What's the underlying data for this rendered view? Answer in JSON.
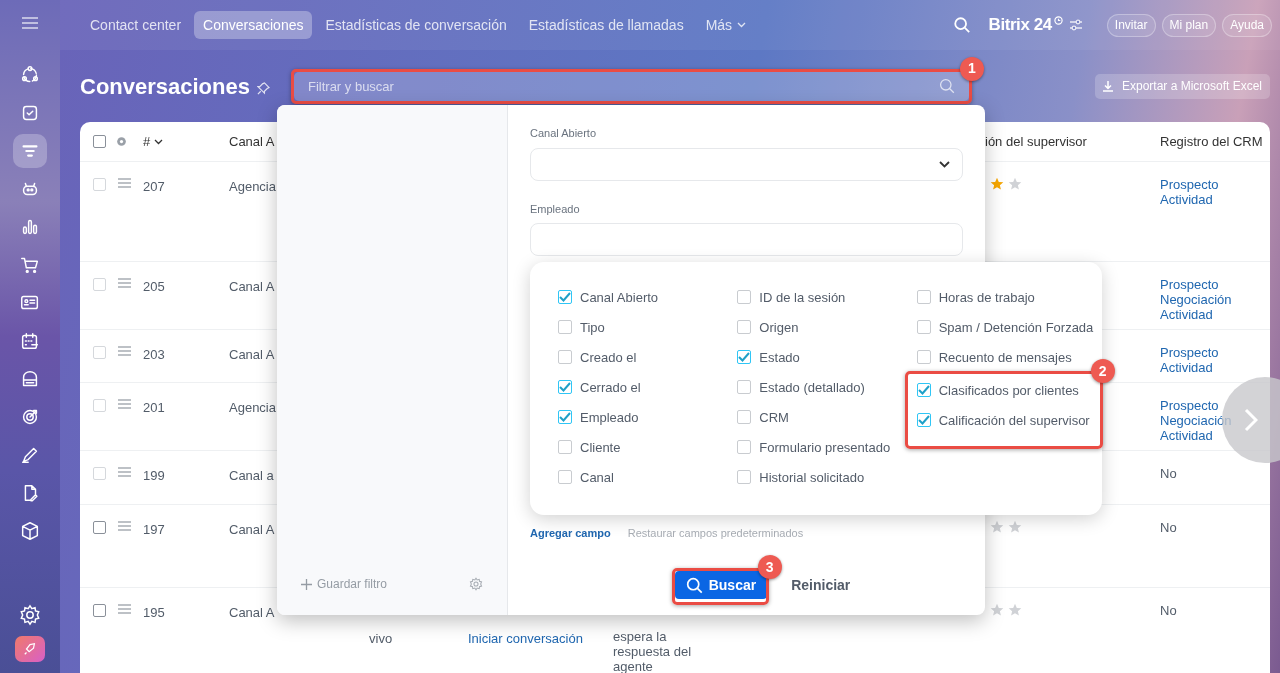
{
  "sidebar": {
    "items": [
      {
        "selected": false
      },
      {
        "selected": false
      },
      {
        "selected": true
      },
      {
        "selected": false
      },
      {
        "selected": false
      },
      {
        "selected": false
      },
      {
        "selected": false
      },
      {
        "selected": false
      },
      {
        "selected": false
      },
      {
        "selected": false
      },
      {
        "selected": false
      },
      {
        "selected": false
      },
      {
        "selected": false
      }
    ]
  },
  "top_nav": {
    "tabs": [
      {
        "label": "Contact center",
        "selected": false
      },
      {
        "label": "Conversaciones",
        "selected": true
      },
      {
        "label": "Estadísticas de conversación",
        "selected": false
      },
      {
        "label": "Estadísticas de llamadas",
        "selected": false
      },
      {
        "label": "Más",
        "selected": false
      }
    ],
    "logo": "Bitrix 24",
    "buttons": [
      "Invitar",
      "Mi plan",
      "Ayuda"
    ]
  },
  "page": {
    "title": "Conversaciones",
    "search": {
      "placeholder": "Filtrar y buscar",
      "callout": "1"
    },
    "export_button": "Exportar a Microsoft Excel"
  },
  "table": {
    "select_all_checked": false,
    "columns": [
      "#",
      "Canal A",
      "ión del supervisor",
      "Registro del CRM"
    ],
    "rows": [
      {
        "id": "207",
        "checked": false,
        "channel": "Agencia",
        "star_icons": [
          {
            "kind": "filled"
          },
          {
            "kind": "empty"
          }
        ],
        "crm": [
          "Prospecto",
          "Actividad"
        ]
      },
      {
        "id": "205",
        "checked": false,
        "channel": "Canal A",
        "crm": [
          "Prospecto",
          "Negociación",
          "Actividad"
        ]
      },
      {
        "id": "203",
        "checked": false,
        "channel": "Canal A",
        "crm": [
          "Prospecto",
          "Actividad"
        ]
      },
      {
        "id": "201",
        "checked": false,
        "channel": "Agencia",
        "crm": [
          "Prospecto",
          "Negociación",
          "Actividad"
        ]
      },
      {
        "id": "199",
        "checked": false,
        "channel": "Canal a",
        "crm_text": "No"
      },
      {
        "id": "197",
        "checked": false,
        "channel": "Canal A",
        "star_icons": [
          {
            "kind": "empty"
          },
          {
            "kind": "empty"
          }
        ],
        "crm_text": "No"
      },
      {
        "id": "195",
        "checked": false,
        "channel": "Canal A",
        "star_icons": [
          {
            "kind": "empty"
          },
          {
            "kind": "empty"
          }
        ],
        "crm_text": "No",
        "column_4": "vivo",
        "column_5": "Iniciar conversación",
        "column_6": "espera la respuesta del agente"
      }
    ]
  },
  "filter": {
    "save_filter": "Guardar filtro",
    "fields": [
      {
        "label": "Canal Abierto",
        "kind": "select"
      },
      {
        "label": "Empleado",
        "kind": "text"
      }
    ],
    "add_field": "Agregar campo",
    "restore_fields": "Restaurar campos predeterminados",
    "search_button": {
      "label": "Buscar",
      "callout": "3"
    },
    "reset_button": "Reiniciar"
  },
  "field_chooser": {
    "callout": "2",
    "columns": [
      [
        {
          "label": "Canal Abierto",
          "checked": true,
          "highlighted": false
        },
        {
          "label": "Tipo",
          "checked": false,
          "highlighted": false
        },
        {
          "label": "Creado el",
          "checked": false,
          "highlighted": false
        },
        {
          "label": "Cerrado el",
          "checked": true,
          "highlighted": false
        },
        {
          "label": "Empleado",
          "checked": true,
          "highlighted": false
        },
        {
          "label": "Cliente",
          "checked": false,
          "highlighted": false
        },
        {
          "label": "Canal",
          "checked": false,
          "highlighted": false
        }
      ],
      [
        {
          "label": "ID de la sesión",
          "checked": false,
          "highlighted": false
        },
        {
          "label": "Origen",
          "checked": false,
          "highlighted": false
        },
        {
          "label": "Estado",
          "checked": true,
          "highlighted": false
        },
        {
          "label": "Estado (detallado)",
          "checked": false,
          "highlighted": false
        },
        {
          "label": "CRM",
          "checked": false,
          "highlighted": false
        },
        {
          "label": "Formulario presentado",
          "checked": false,
          "highlighted": false
        },
        {
          "label": "Historial solicitado",
          "checked": false,
          "highlighted": false
        }
      ],
      [
        {
          "label": "Horas de trabajo",
          "checked": false,
          "highlighted": false
        },
        {
          "label": "Spam / Detención Forzada",
          "checked": false,
          "highlighted": false
        },
        {
          "label": "Recuento de mensajes",
          "checked": false,
          "highlighted": false
        },
        {
          "label": "Clasificados por clientes",
          "checked": true,
          "highlighted": true
        },
        {
          "label": "Calificación del supervisor",
          "checked": true,
          "highlighted": true
        }
      ]
    ]
  }
}
